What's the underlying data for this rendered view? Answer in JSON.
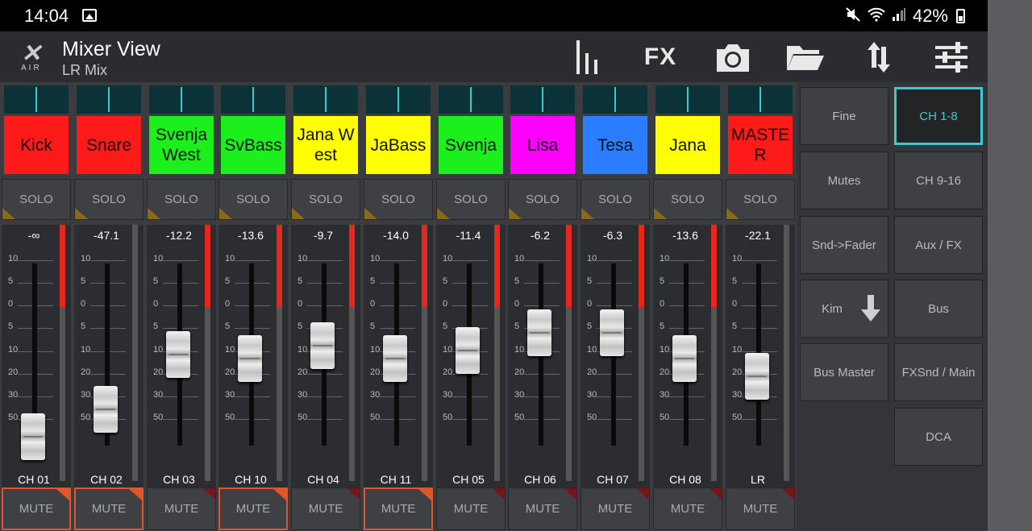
{
  "status": {
    "time": "14:04",
    "battery": "42%"
  },
  "header": {
    "title": "Mixer View",
    "subtitle": "LR Mix",
    "logo_text": "AIR",
    "fx_label": "FX"
  },
  "scale": [
    "10",
    "5",
    "0",
    "5",
    "10",
    "20",
    "30",
    "50"
  ],
  "channels": [
    {
      "name": "Kick",
      "color": "#ff1a1a",
      "solo_label": "SOLO",
      "value": "-∞",
      "level": 0.32,
      "label": "CH 01",
      "mute_label": "MUTE",
      "mute_active": true,
      "fader": 0.95
    },
    {
      "name": "Snare",
      "color": "#ff1a1a",
      "solo_label": "SOLO",
      "value": "-47.1",
      "level": 0.0,
      "label": "CH 02",
      "mute_label": "MUTE",
      "mute_active": true,
      "fader": 0.8
    },
    {
      "name": "Svenja West",
      "color": "#1cf01c",
      "solo_label": "SOLO",
      "value": "-12.2",
      "level": 0.32,
      "label": "CH 03",
      "mute_label": "MUTE",
      "mute_active": false,
      "fader": 0.5
    },
    {
      "name": "SvBass",
      "color": "#1cf01c",
      "solo_label": "SOLO",
      "value": "-13.6",
      "level": 0.32,
      "label": "CH 10",
      "mute_label": "MUTE",
      "mute_active": true,
      "fader": 0.52
    },
    {
      "name": "Jana West",
      "color": "#ffff00",
      "solo_label": "SOLO",
      "value": "-9.7",
      "level": 0.32,
      "label": "CH 04",
      "mute_label": "MUTE",
      "mute_active": false,
      "fader": 0.45
    },
    {
      "name": "JaBass",
      "color": "#ffff00",
      "solo_label": "SOLO",
      "value": "-14.0",
      "level": 0.32,
      "label": "CH 11",
      "mute_label": "MUTE",
      "mute_active": true,
      "fader": 0.52
    },
    {
      "name": "Svenja",
      "color": "#1cf01c",
      "solo_label": "SOLO",
      "value": "-11.4",
      "level": 0.32,
      "label": "CH 05",
      "mute_label": "MUTE",
      "mute_active": false,
      "fader": 0.48
    },
    {
      "name": "Lisa",
      "color": "#ff00ff",
      "solo_label": "SOLO",
      "value": "-6.2",
      "level": 0.32,
      "label": "CH 06",
      "mute_label": "MUTE",
      "mute_active": false,
      "fader": 0.38
    },
    {
      "name": "Tesa",
      "color": "#2a7dff",
      "solo_label": "SOLO",
      "value": "-6.3",
      "level": 0.32,
      "label": "CH 07",
      "mute_label": "MUTE",
      "mute_active": false,
      "fader": 0.38
    },
    {
      "name": "Jana",
      "color": "#ffff00",
      "solo_label": "SOLO",
      "value": "-13.6",
      "level": 0.32,
      "label": "CH 08",
      "mute_label": "MUTE",
      "mute_active": false,
      "fader": 0.52
    },
    {
      "name": "MASTER",
      "color": "#ff1a1a",
      "solo_label": "SOLO",
      "value": "-22.1",
      "level": 0.0,
      "label": "LR",
      "mute_label": "MUTE",
      "mute_active": false,
      "fader": 0.62
    }
  ],
  "right_panel": [
    {
      "label": "Fine",
      "active": false
    },
    {
      "label": "CH 1-8",
      "active": true
    },
    {
      "label": "Mutes",
      "active": false
    },
    {
      "label": "CH 9-16",
      "active": false
    },
    {
      "label": "Snd->Fader",
      "active": false
    },
    {
      "label": "Aux / FX",
      "active": false
    },
    {
      "label": "Kim",
      "active": false,
      "icon": "arrow-down-icon"
    },
    {
      "label": "Bus",
      "active": false
    },
    {
      "label": "Bus Master",
      "active": false
    },
    {
      "label": "FXSnd / Main",
      "active": false
    },
    {
      "label": "DCA",
      "active": false
    }
  ]
}
